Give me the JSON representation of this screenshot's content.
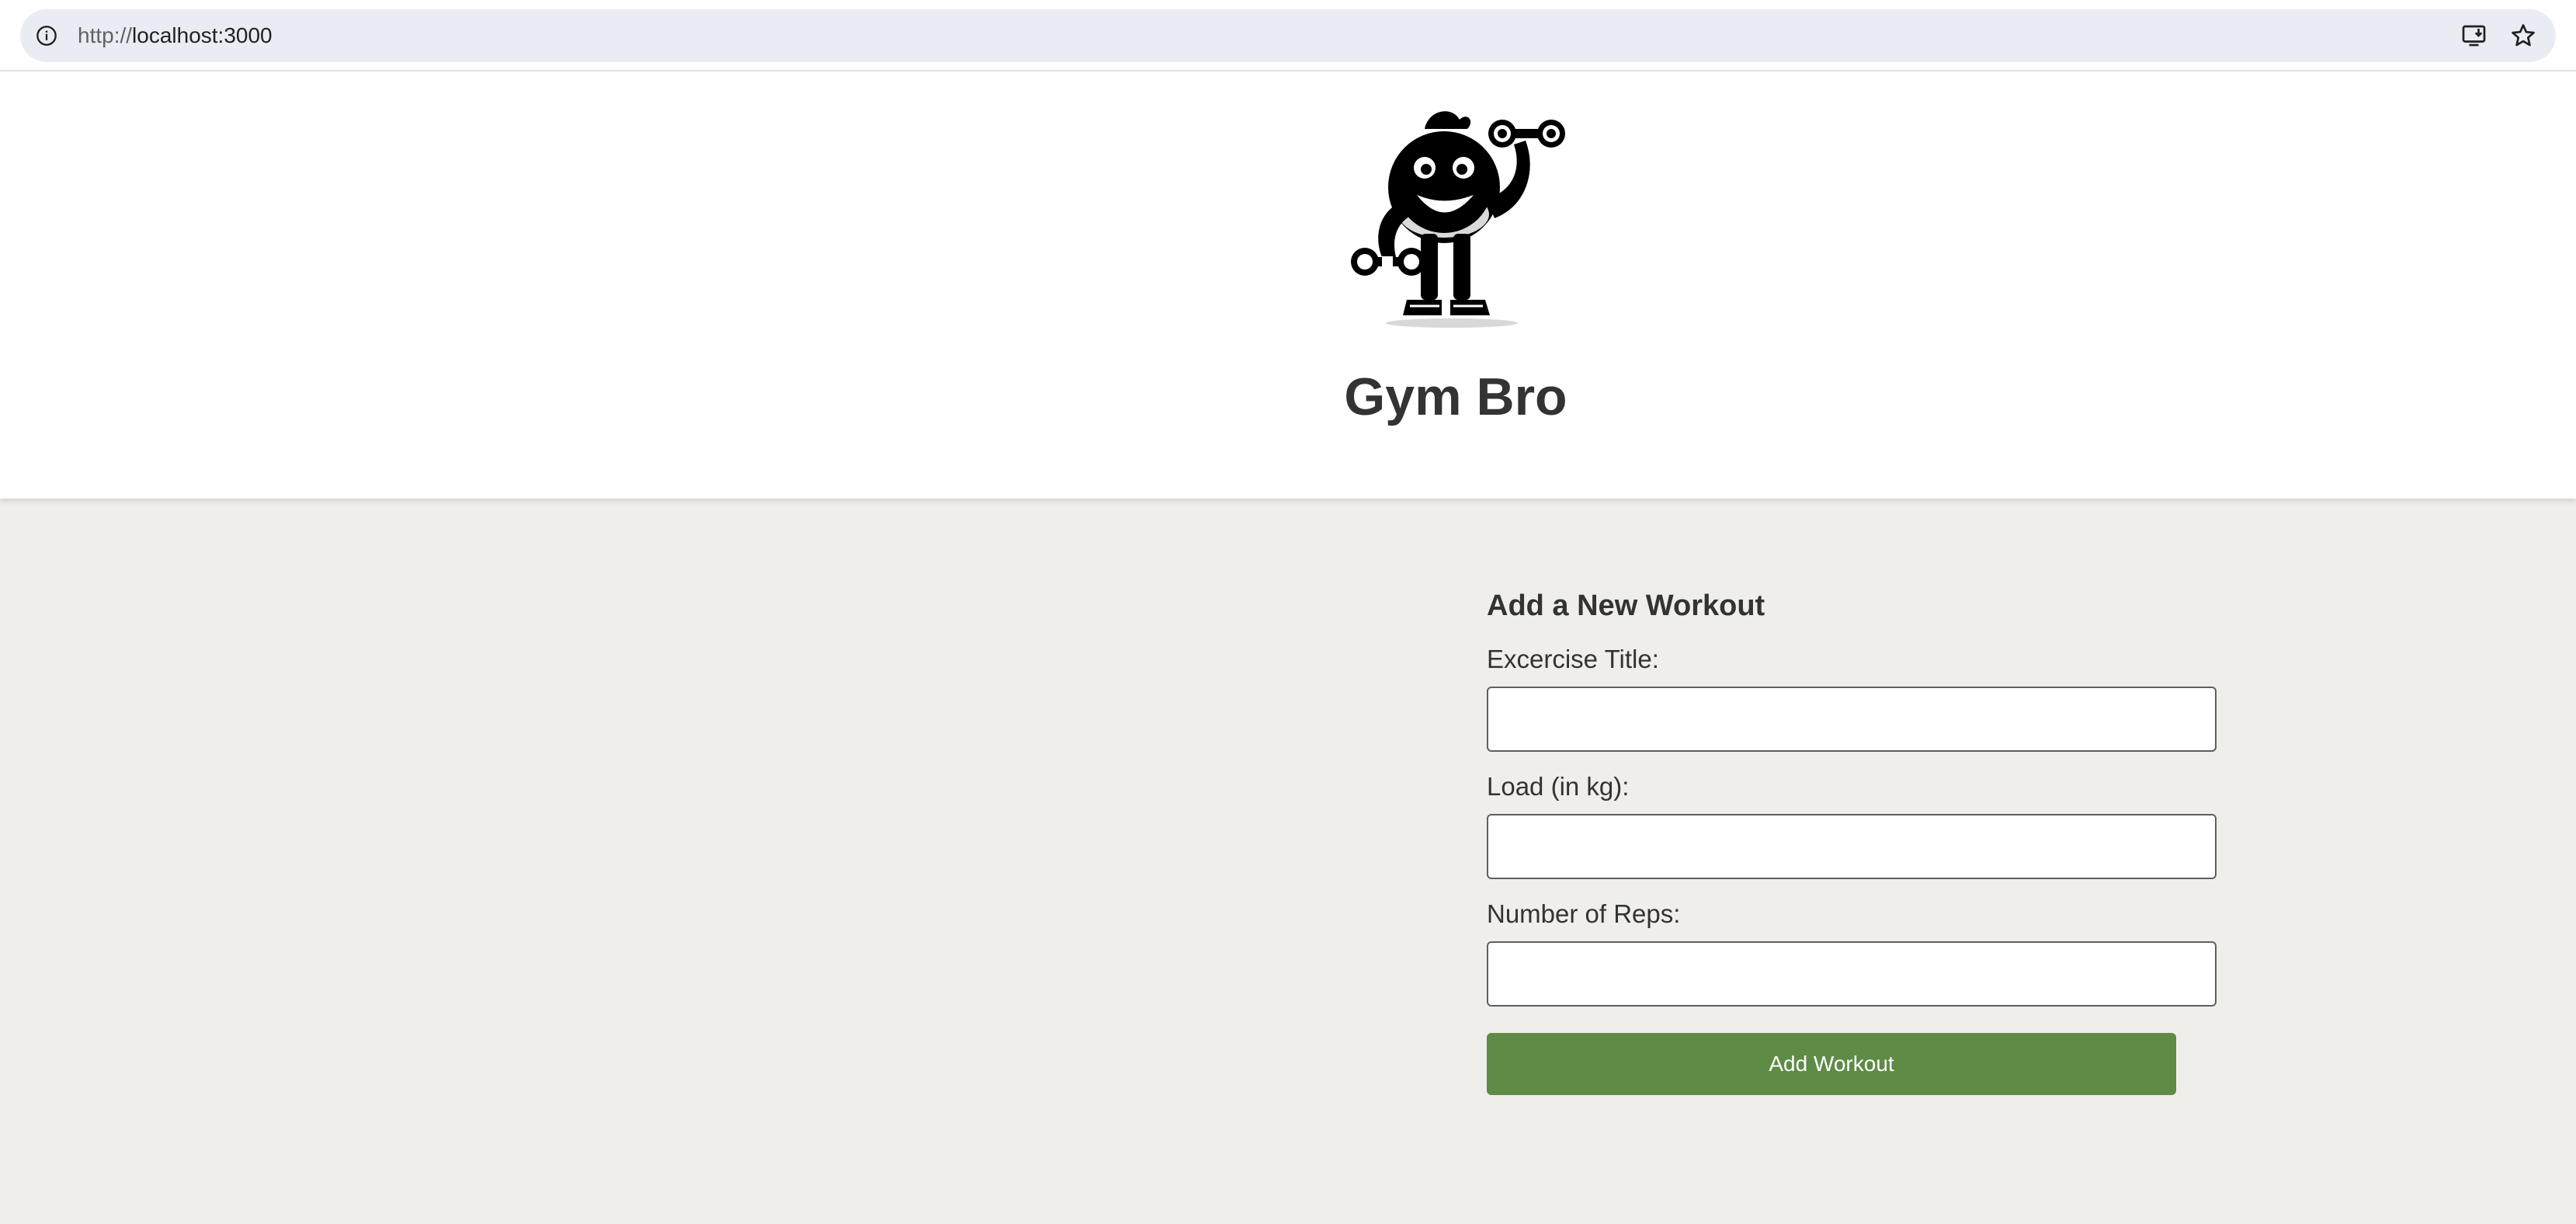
{
  "browser": {
    "url_prefix": "http://",
    "url_host": "localhost:3000",
    "icons": [
      "info-icon",
      "install-app-icon",
      "bookmark-star-icon"
    ]
  },
  "header": {
    "logo_icon": "gym-mascot-dumbbell-logo",
    "title": "Gym Bro"
  },
  "form": {
    "heading": "Add a New Workout",
    "fields": [
      {
        "label": "Excercise Title:",
        "value": "",
        "placeholder": ""
      },
      {
        "label": "Load (in kg):",
        "value": "",
        "placeholder": ""
      },
      {
        "label": "Number of Reps:",
        "value": "",
        "placeholder": ""
      }
    ],
    "submit_label": "Add Workout"
  },
  "colors": {
    "page_background": "#efeeea",
    "header_background": "#ffffff",
    "button_green": "#5e8b45",
    "text_dark": "#333333"
  }
}
